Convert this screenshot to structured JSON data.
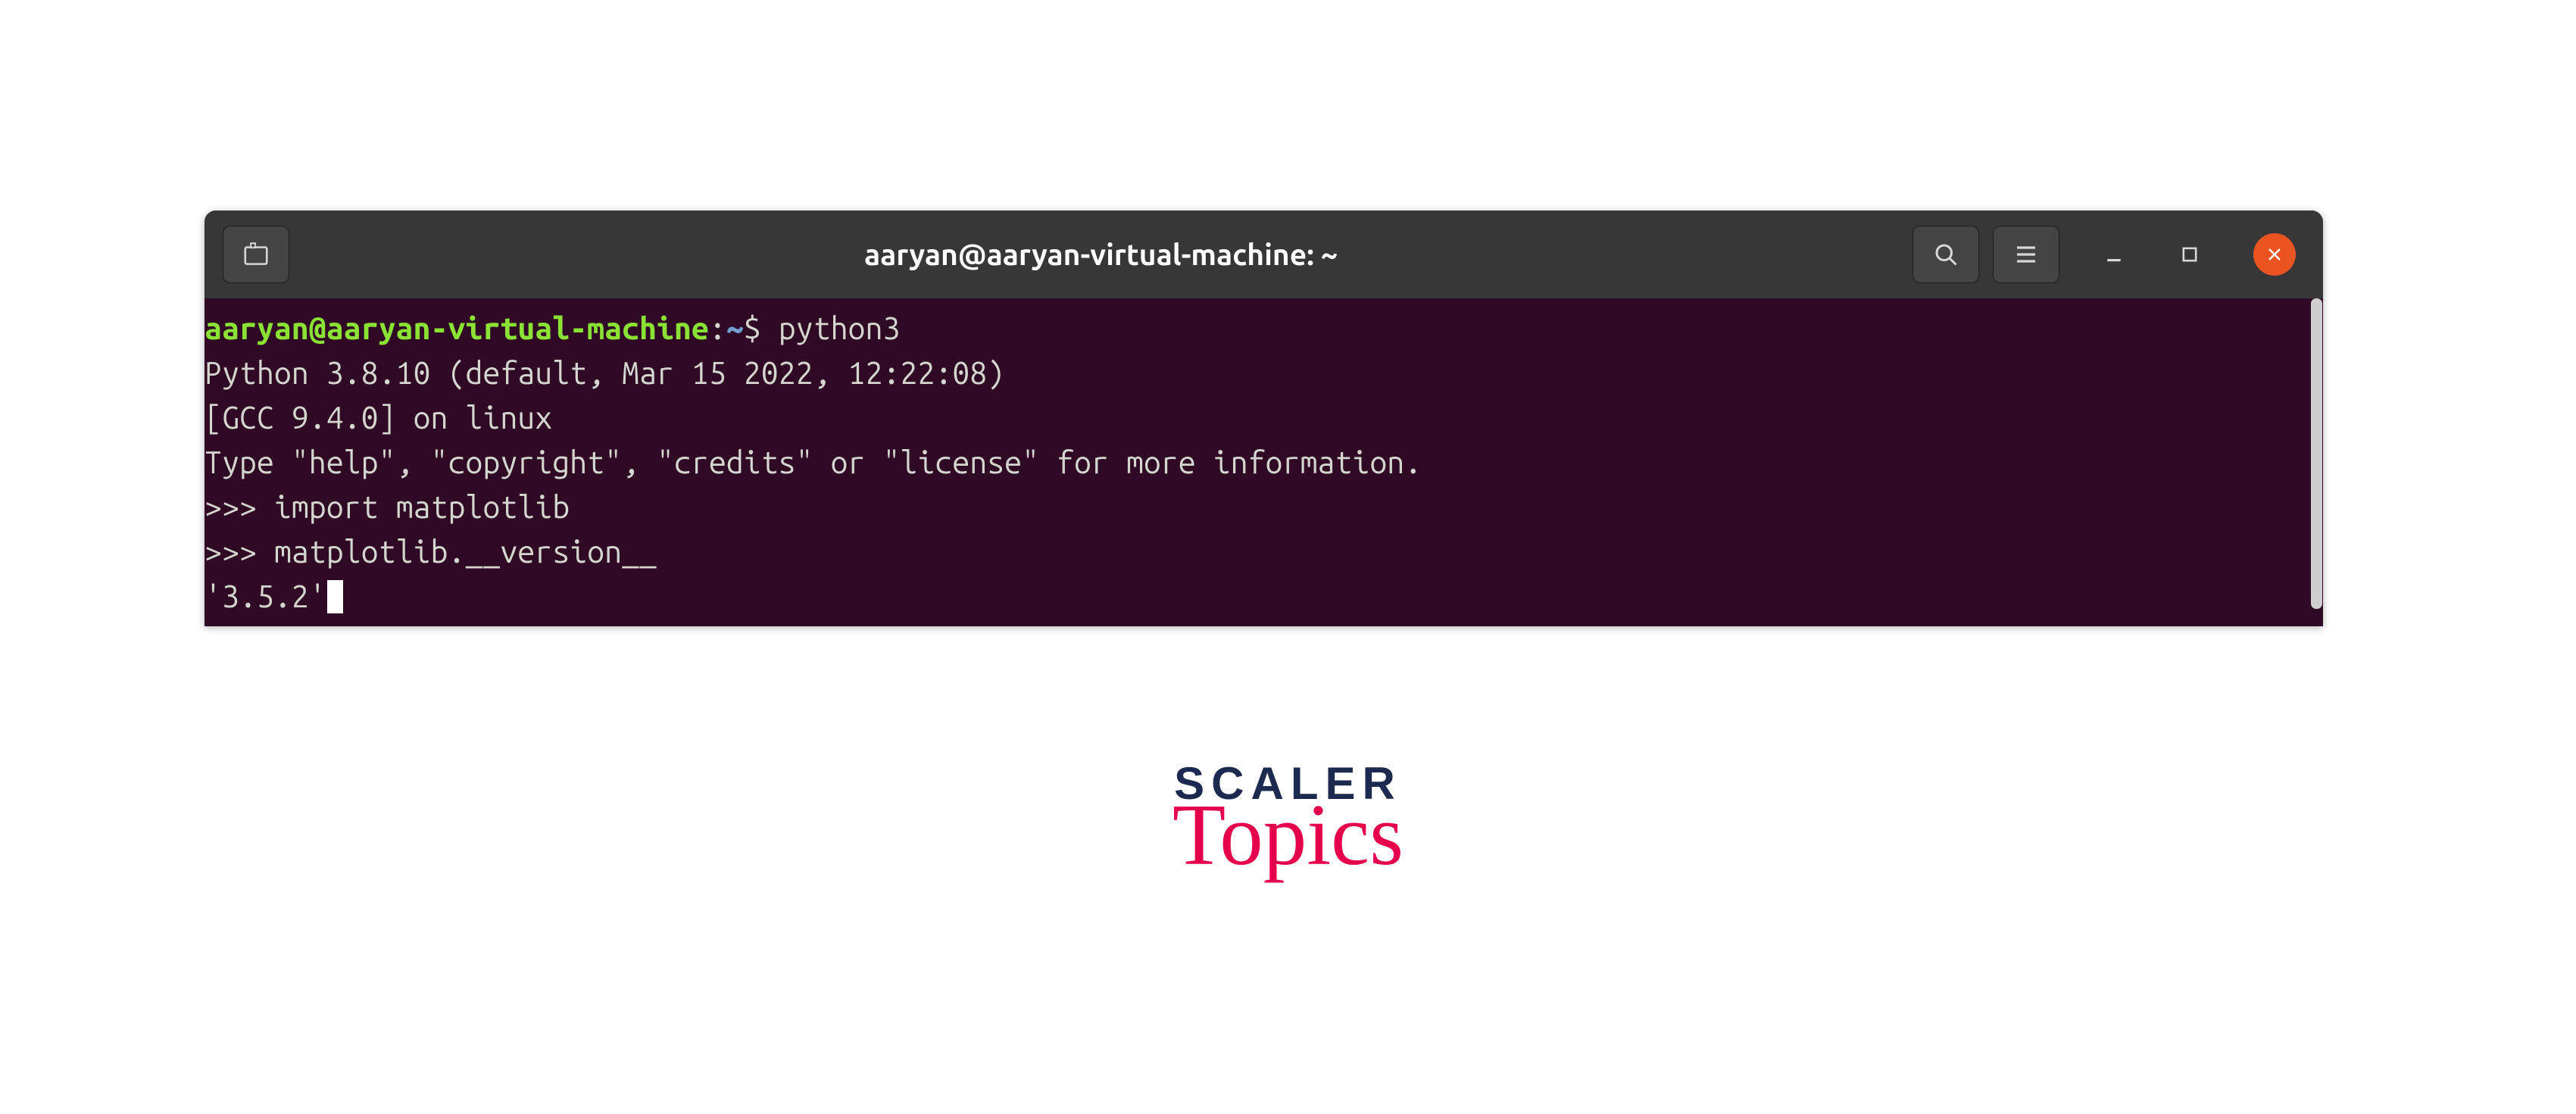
{
  "titlebar": {
    "title": "aaryan@aaryan-virtual-machine: ~"
  },
  "terminal": {
    "prompt_user_host": "aaryan@aaryan-virtual-machine",
    "prompt_sep": ":",
    "prompt_path": "~",
    "prompt_dollar": "$ ",
    "cmd1": "python3",
    "line_py_version": "Python 3.8.10 (default, Mar 15 2022, 12:22:08) ",
    "line_gcc": "[GCC 9.4.0] on linux",
    "line_help": "Type \"help\", \"copyright\", \"credits\" or \"license\" for more information.",
    "repl_prompt": ">>> ",
    "repl_cmd1": "import matplotlib",
    "repl_cmd2": "matplotlib.__version__",
    "output1": "'3.5.2'"
  },
  "logo": {
    "line1": "SCALER",
    "line2": "Topics"
  }
}
